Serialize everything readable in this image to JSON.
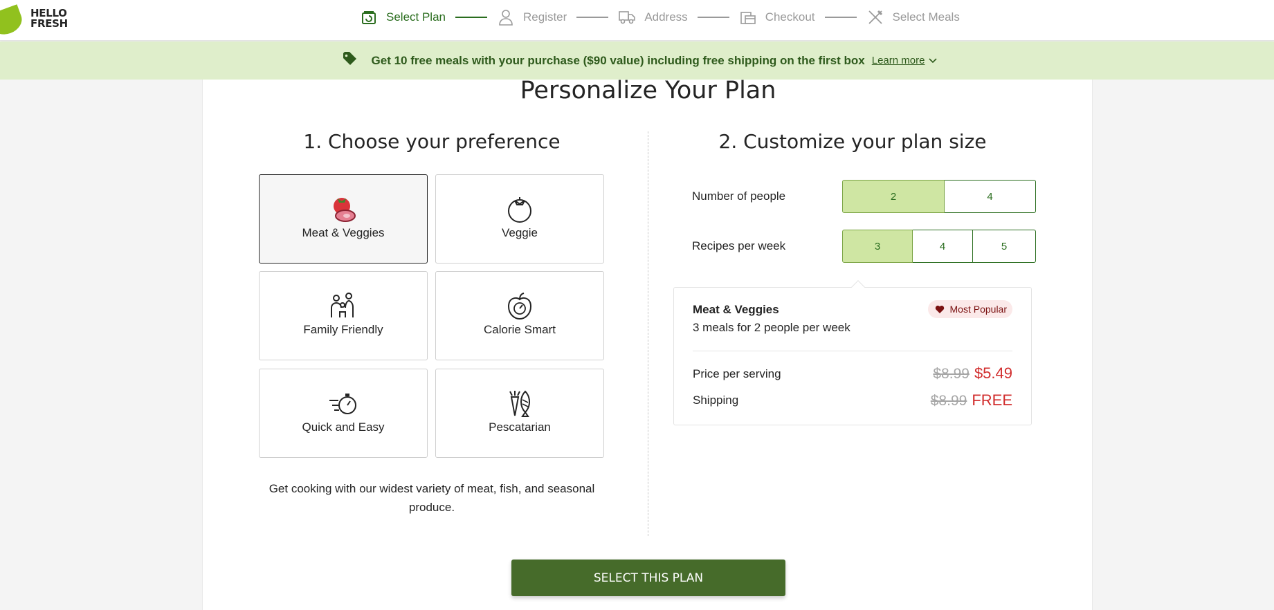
{
  "brand": {
    "logo_line1": "HELLO",
    "logo_line2": "FRESH"
  },
  "steps": [
    {
      "label": "Select Plan",
      "icon": "calendar-box-icon",
      "active": true
    },
    {
      "label": "Register",
      "icon": "user-icon",
      "active": false
    },
    {
      "label": "Address",
      "icon": "delivery-truck-icon",
      "active": false
    },
    {
      "label": "Checkout",
      "icon": "card-icon",
      "active": false
    },
    {
      "label": "Select Meals",
      "icon": "fork-knife-icon",
      "active": false
    }
  ],
  "promo": {
    "icon": "price-tag-icon",
    "text": "Get 10 free meals with your purchase ($90 value) including free shipping on the first box",
    "link": "Learn more"
  },
  "main": {
    "title": "Personalize Your Plan",
    "preference": {
      "title": "1. Choose your preference",
      "options": [
        {
          "label": "Meat & Veggies",
          "icon": "meat-tomato-icon",
          "selected": true
        },
        {
          "label": "Veggie",
          "icon": "tomato-icon",
          "selected": false
        },
        {
          "label": "Family Friendly",
          "icon": "family-icon",
          "selected": false
        },
        {
          "label": "Calorie Smart",
          "icon": "apple-scale-icon",
          "selected": false
        },
        {
          "label": "Quick and Easy",
          "icon": "stopwatch-icon",
          "selected": false
        },
        {
          "label": "Pescatarian",
          "icon": "carrot-fish-icon",
          "selected": false
        }
      ],
      "description": "Get cooking with our widest variety of meat, fish, and seasonal produce."
    },
    "plan_size": {
      "title": "2. Customize your plan size",
      "people": {
        "label": "Number of people",
        "options": [
          "2",
          "4"
        ],
        "selected": "2"
      },
      "recipes": {
        "label": "Recipes per week",
        "options": [
          "3",
          "4",
          "5"
        ],
        "selected": "3"
      }
    },
    "summary": {
      "plan_name": "Meat & Veggies",
      "plan_desc": "3 meals for 2 people per week",
      "badge": "Most Popular",
      "price_label": "Price per serving",
      "price_old": "$8.99",
      "price_new": "$5.49",
      "shipping_label": "Shipping",
      "shipping_old": "$8.99",
      "shipping_new": "FREE"
    },
    "cta": "SELECT THIS PLAN"
  },
  "colors": {
    "brand_green": "#2a6d1e",
    "cta_green": "#466b2a",
    "selected_fill": "#cfe6a3",
    "promo_bg": "#dfeecb",
    "price_red": "#d12c2c"
  }
}
